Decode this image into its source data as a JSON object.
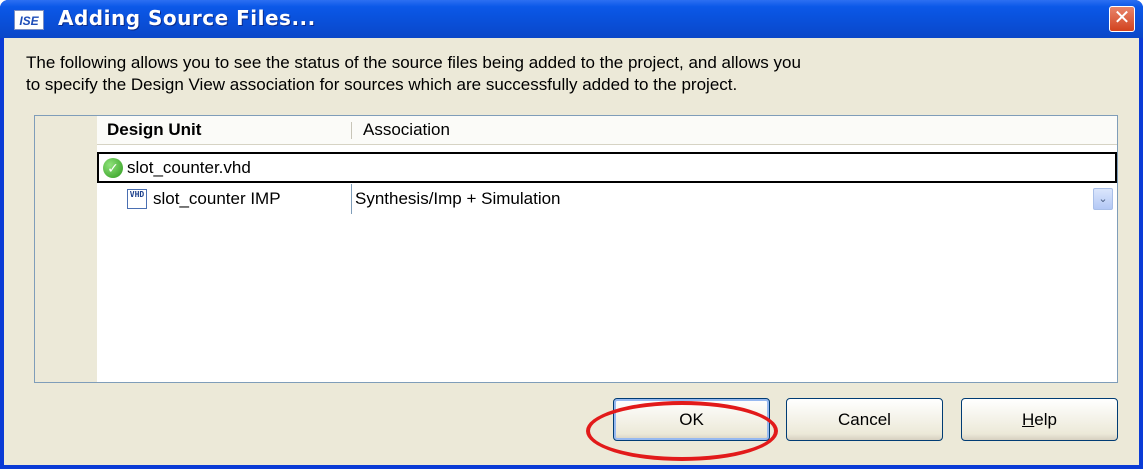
{
  "window": {
    "app_icon_text": "ISE",
    "title": "Adding Source Files...",
    "close_glyph": "✕"
  },
  "description": {
    "line1": "The following allows you to see the status of the source files being added to the project, and allows you",
    "line2": "to specify the Design View association for sources which are successfully added to the project."
  },
  "table": {
    "columns": [
      "Design Unit",
      "Association"
    ],
    "file_row": {
      "status_icon": "check-icon",
      "status_glyph": "✓",
      "name": "slot_counter.vhd"
    },
    "unit_row": {
      "icon": "vhdl-file-icon",
      "icon_text": "VHD",
      "name": "slot_counter IMP",
      "association": "Synthesis/Imp + Simulation",
      "dropdown_glyph": "⌄"
    }
  },
  "buttons": {
    "ok": "OK",
    "cancel": "Cancel",
    "help_first": "H",
    "help_rest": "elp"
  },
  "colors": {
    "titlebar": "#0b58e8",
    "dialog_face": "#ece9d8",
    "highlight": "#e21a1a"
  }
}
